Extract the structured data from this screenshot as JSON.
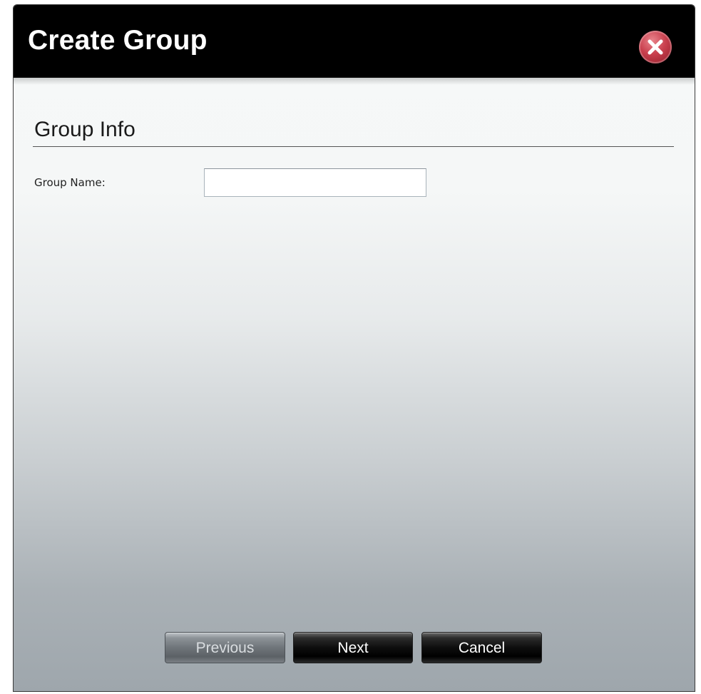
{
  "dialog": {
    "title": "Create Group",
    "close_icon": "close-icon"
  },
  "section": {
    "title": "Group Info"
  },
  "form": {
    "group_name_label": "Group Name:",
    "group_name_value": "",
    "group_name_placeholder": ""
  },
  "buttons": {
    "previous_label": "Previous",
    "previous_enabled": false,
    "next_label": "Next",
    "cancel_label": "Cancel"
  },
  "colors": {
    "titlebar": "#000000",
    "close_button": "#c9404e",
    "dialog_top": "#f6f8f8",
    "dialog_bottom": "#9ea6ac"
  }
}
